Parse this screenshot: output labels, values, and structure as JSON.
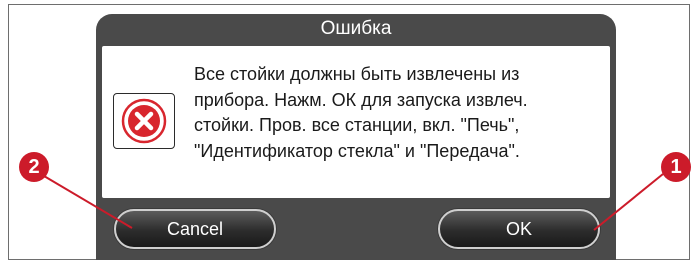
{
  "dialog": {
    "title": "Ошибка",
    "message_lines": [
      "Все стойки должны быть извлечены из",
      "прибора. Нажм. ОК для запуска извлеч.",
      "стойки. Пров. все станции, вкл. \"Печь\",",
      "\"Идентификатор стекла\" и \"Передача\"."
    ],
    "icon": "error-icon",
    "buttons": {
      "cancel_label": "Cancel",
      "ok_label": "OK"
    }
  },
  "callouts": {
    "left_number": "2",
    "right_number": "1"
  },
  "colors": {
    "title_bar": "#4a4a4a",
    "error_red": "#d8262e",
    "callout_red": "#cc1b2a",
    "button_dark": "#2c2c2c"
  }
}
